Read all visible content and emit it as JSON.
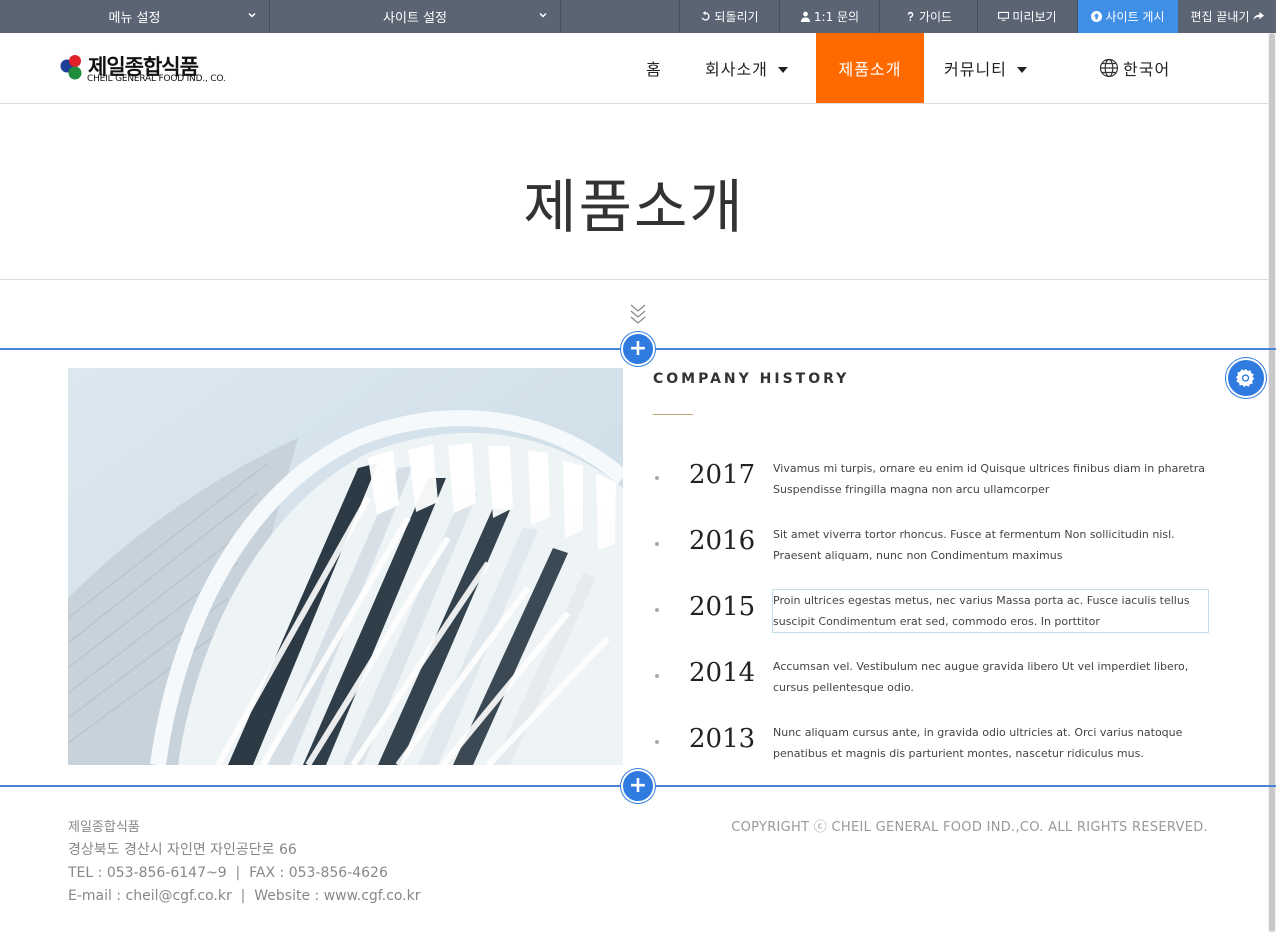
{
  "editor_toolbar": {
    "menu_settings": "메뉴 설정",
    "site_settings": "사이트 설정",
    "undo": "되돌리기",
    "inquiry": "1:1 문의",
    "guide": "가이드",
    "preview": "미리보기",
    "publish": "사이트 게시",
    "finish_edit": "편집 끝내기",
    "publish_color": "#3f8fe6"
  },
  "header": {
    "logo_korean": "제일종합식품",
    "logo_english": "CHEIL GENERAL FOOD IND., CO.",
    "nav": {
      "home": "홈",
      "company": "회사소개",
      "products": "제품소개",
      "community": "커뮤니티",
      "language": "한국어"
    },
    "active_color": "#ff6a00"
  },
  "page": {
    "title": "제품소개"
  },
  "history": {
    "title": "COMPANY HISTORY",
    "items": [
      {
        "year": "2017",
        "text": "Vivamus mi turpis, ornare eu enim id Quisque ultrices finibus diam in pharetra Suspendisse fringilla magna non arcu ullamcorper"
      },
      {
        "year": "2016",
        "text": "Sit amet viverra tortor rhoncus. Fusce at fermentum Non sollicitudin nisl. Praesent aliquam, nunc non Condimentum maximus"
      },
      {
        "year": "2015",
        "text": "Proin ultrices egestas metus, nec varius Massa porta ac. Fusce iaculis tellus suscipit Condimentum erat sed, commodo eros. In porttitor"
      },
      {
        "year": "2014",
        "text": "Accumsan vel. Vestibulum nec augue gravida libero Ut vel imperdiet libero, cursus pellentesque odio."
      },
      {
        "year": "2013",
        "text": "Nunc aliquam cursus ante, in gravida odio ultricies at. Orci varius natoque penatibus et magnis dis parturient montes, nascetur ridiculus mus."
      }
    ]
  },
  "footer": {
    "company": "제일종합식품",
    "address": "경상북도 경산시 자인면 자인공단로 66",
    "phone_fax": "TEL : 053-856-6147~9  |  FAX : 053-856-4626",
    "email_web": "E-mail : cheil@cgf.co.kr  |  Website : www.cgf.co.kr",
    "copyright": "COPYRIGHT ⓒ CHEIL GENERAL FOOD IND.,CO. ALL RIGHTS RESERVED."
  },
  "editor_accent": "#2f7be0"
}
